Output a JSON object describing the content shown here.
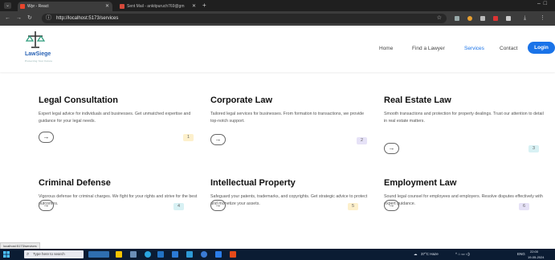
{
  "browser": {
    "tabs": [
      {
        "label": "Wpr - React",
        "active": true
      },
      {
        "label": "Sent Mail - ankitpuruch769@gm",
        "active": false
      }
    ],
    "url": "http://localhost:5173/services"
  },
  "site": {
    "logo_text": "LawSiege",
    "logo_tag": "Protecting Your Future",
    "nav": [
      "Home",
      "Find a Lawyer",
      "Services",
      "Contact"
    ],
    "active_nav": "Services",
    "login_label": "Login",
    "accent": "#1a73e8"
  },
  "services": [
    {
      "title": "Legal Consultation",
      "desc": "Expert legal advice for individuals and businesses. Get unmatched expertise and guidance for your legal needs.",
      "num": "1",
      "badge_color": "#fdf0cc",
      "arrow": "→"
    },
    {
      "title": "Corporate Law",
      "desc": "Tailored legal services for businesses. From formation to transactions, we provide top-notch support.",
      "num": "2",
      "badge_color": "#e6e2f7",
      "arrow": "→"
    },
    {
      "title": "Real Estate Law",
      "desc": "Smooth transactions and protection for property dealings. Trust our attention to detail in real estate matters.",
      "num": "3",
      "badge_color": "#d8f1f4",
      "arrow": "→"
    },
    {
      "title": "Criminal Defense",
      "desc": "Vigorous defense for criminal charges. We fight for your rights and strive for the best outcomes.",
      "num": "4",
      "badge_color": "#d8f1f4",
      "arrow": "→"
    },
    {
      "title": "Intellectual Property",
      "desc": "Safeguard your patents, trademarks, and copyrights. Get strategic advice to protect and monetize your assets.",
      "num": "5",
      "badge_color": "#fdf0cc",
      "arrow": "→"
    },
    {
      "title": "Employment Law",
      "desc": "Sound legal counsel for employees and employers. Resolve disputes effectively with expert guidance.",
      "num": "6",
      "badge_color": "#e6e2f7",
      "arrow": "→"
    }
  ],
  "status_url": "localhost:5173/services",
  "taskbar": {
    "search_placeholder": "Type here to search",
    "weather": "37°C Haze",
    "lang": "ENG",
    "time": "22:00",
    "date": "19-05-2024"
  }
}
